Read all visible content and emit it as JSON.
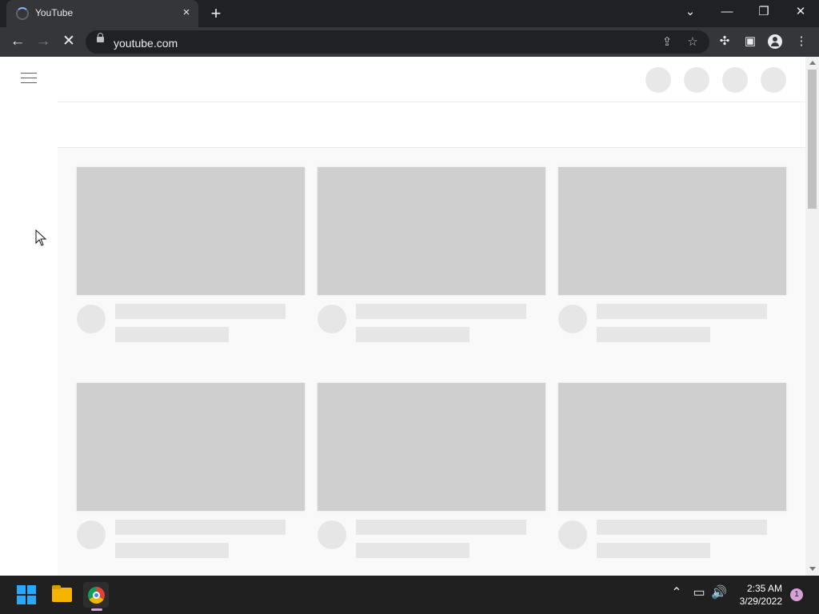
{
  "browser": {
    "tab_title": "YouTube",
    "tab_close": "×",
    "new_tab": "+",
    "url": "youtube.com",
    "icons": {
      "back": "arrow-left-icon",
      "forward": "arrow-right-icon",
      "stop": "close-icon",
      "share": "share-icon",
      "bookmark": "star-icon",
      "extensions": "puzzle-icon",
      "side_panel": "side-panel-icon",
      "profile": "profile-icon",
      "menu": "kebab-menu-icon",
      "tab_search": "chevron-down-icon",
      "minimize": "minimize-icon",
      "restore": "restore-icon",
      "close_window": "close-icon"
    }
  },
  "youtube": {
    "loading_cards": [
      {
        "state": "loading"
      },
      {
        "state": "loading"
      },
      {
        "state": "loading"
      },
      {
        "state": "loading"
      },
      {
        "state": "loading"
      },
      {
        "state": "loading"
      }
    ]
  },
  "taskbar": {
    "clock_time": "2:35 AM",
    "clock_date": "3/29/2022",
    "notification_count": "1",
    "pinned_apps": [
      "windows-start-icon",
      "file-explorer-icon",
      "chrome-icon"
    ]
  }
}
